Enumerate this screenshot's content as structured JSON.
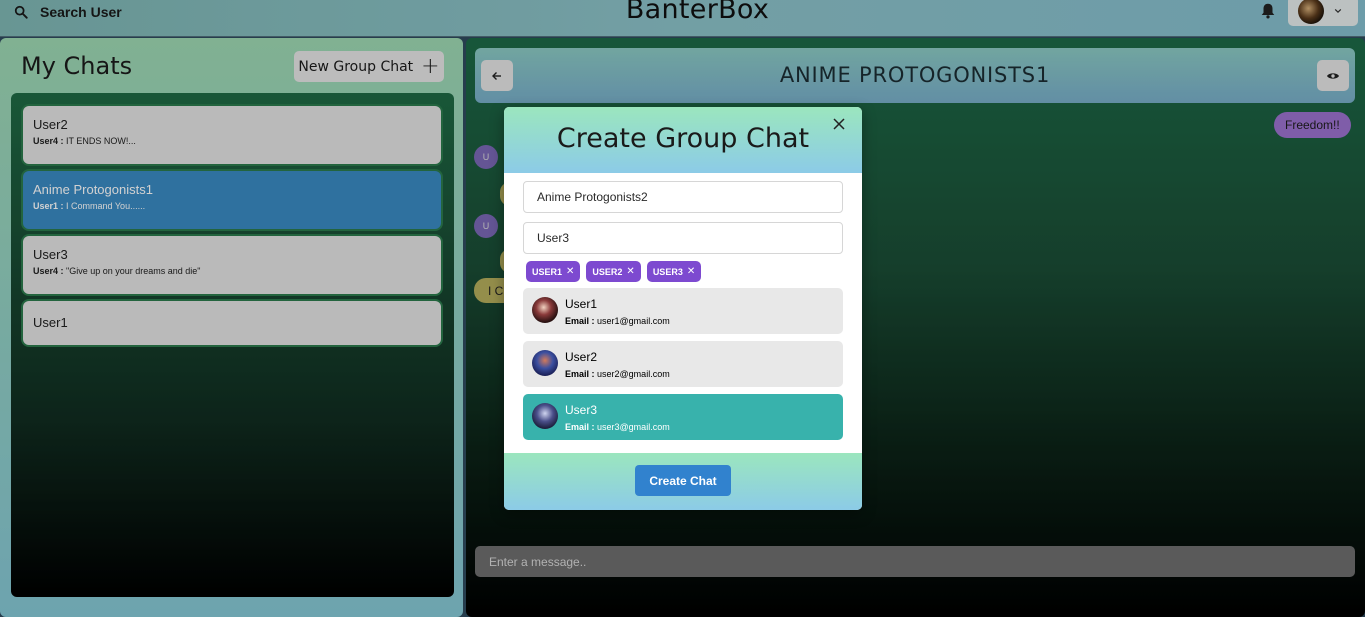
{
  "topbar": {
    "search_label": "Search User",
    "app_title": "BanterBox",
    "icons": [
      "search-icon",
      "bell-icon",
      "chevron-down-icon"
    ]
  },
  "sidebar": {
    "title": "My Chats",
    "new_group_label": "New Group Chat",
    "chats": [
      {
        "name": "User2",
        "sender": "User4 :",
        "latest": "IT ENDS NOW!..."
      },
      {
        "name": "Anime Protogonists1",
        "sender": "User1 :",
        "latest": "I Command You......"
      },
      {
        "name": "User3",
        "sender": "User4 :",
        "latest": "\"Give up on your dreams and die\""
      },
      {
        "name": "User1",
        "sender": "",
        "latest": ""
      }
    ]
  },
  "chat": {
    "title": "ANIME PROTOGONISTS1",
    "messages": [
      {
        "side": "right",
        "text": "Freedom!!"
      },
      {
        "side": "left",
        "avatar": "U",
        "text": ""
      },
      {
        "side": "left",
        "avatar": "U",
        "text": ""
      },
      {
        "side": "left",
        "text": "I C"
      }
    ],
    "input_placeholder": "Enter a message.."
  },
  "modal": {
    "title": "Create Group Chat",
    "chat_name_value": "Anime Protogonists2",
    "search_value": "User3",
    "tags": [
      {
        "label": "USER1"
      },
      {
        "label": "USER2"
      },
      {
        "label": "USER3"
      }
    ],
    "email_label": "Email :",
    "results": [
      {
        "name": "User1",
        "email": "user1@gmail.com",
        "selected": false
      },
      {
        "name": "User2",
        "email": "user2@gmail.com",
        "selected": false
      },
      {
        "name": "User3",
        "email": "user3@gmail.com",
        "selected": true
      }
    ],
    "create_label": "Create Chat"
  },
  "colors": {
    "accent_blue": "#3182ce",
    "active_chat": "#3a8ac2",
    "tag_purple": "#7d4ad0",
    "selected_teal": "#38b2ac"
  }
}
